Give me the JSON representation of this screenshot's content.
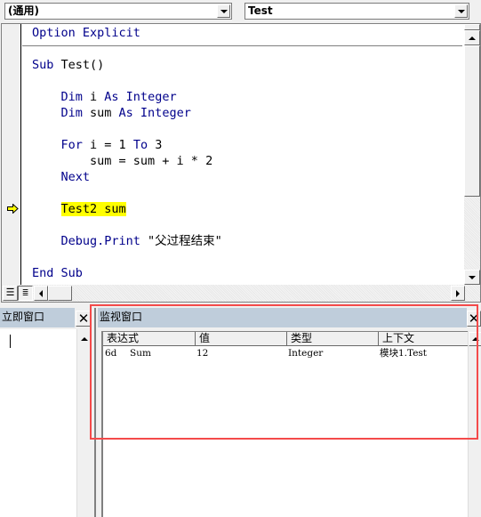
{
  "toolbar": {
    "object_dropdown": "(通用)",
    "procedure_dropdown": "Test"
  },
  "code_window": {
    "declarations": [
      {
        "segments": [
          {
            "t": "Option Explicit",
            "kw": true
          }
        ]
      }
    ],
    "lines": [
      {
        "segments": [
          {
            "t": "Sub ",
            "kw": true
          },
          {
            "t": "Test()",
            "kw": false
          }
        ]
      },
      {
        "segments": [
          {
            "t": "    Dim ",
            "kw": true
          },
          {
            "t": "i ",
            "kw": false
          },
          {
            "t": "As Integer",
            "kw": true
          }
        ]
      },
      {
        "segments": [
          {
            "t": "    Dim ",
            "kw": true
          },
          {
            "t": "sum ",
            "kw": false
          },
          {
            "t": "As Integer",
            "kw": true
          }
        ]
      },
      {
        "segments": [
          {
            "t": "    For ",
            "kw": true
          },
          {
            "t": "i = 1 ",
            "kw": false
          },
          {
            "t": "To ",
            "kw": true
          },
          {
            "t": "3",
            "kw": false
          }
        ]
      },
      {
        "segments": [
          {
            "t": "        sum = sum + i * 2",
            "kw": false
          }
        ]
      },
      {
        "segments": [
          {
            "t": "    Next",
            "kw": true
          }
        ]
      },
      {
        "segments": [
          {
            "t": "    Test2 sum",
            "kw": false
          }
        ],
        "current": true
      },
      {
        "segments": [
          {
            "t": "    Debug.Print ",
            "kw": true
          },
          {
            "t": "\"父过程结束\"",
            "kw": false
          }
        ]
      },
      {
        "segments": [
          {
            "t": "End Sub",
            "kw": true
          }
        ]
      }
    ],
    "execution_marker_icon": "current-line-arrow-icon",
    "highlight_color": "#ffff00",
    "keyword_color": "#00008b"
  },
  "immediate_window": {
    "title": "立即窗口",
    "content": ""
  },
  "watch_window": {
    "title": "监视窗口",
    "columns": [
      "表达式",
      "值",
      "类型",
      "上下文"
    ],
    "rows": [
      {
        "icon": "6d",
        "expression": "Sum",
        "value": "12",
        "type": "Integer",
        "context": "模块1.Test"
      }
    ]
  },
  "annotation": {
    "color": "#f44a4a"
  }
}
